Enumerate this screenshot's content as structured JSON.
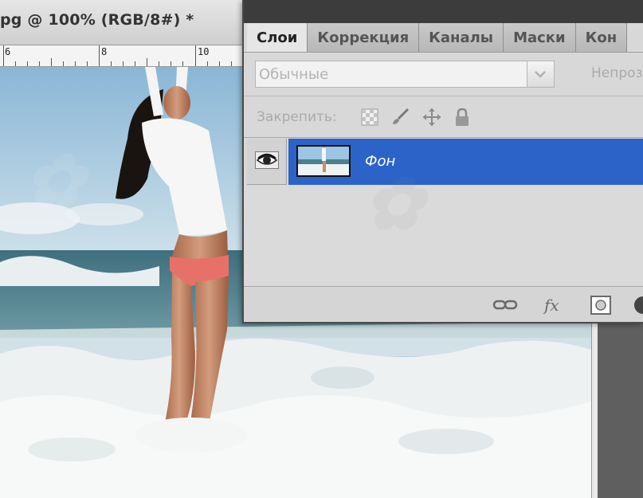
{
  "document": {
    "title": "pg @ 100% (RGB/8#) *",
    "ruler_numbers": [
      "6",
      "8",
      "10"
    ]
  },
  "layers_panel": {
    "tabs": [
      {
        "label": "Слои",
        "active": true
      },
      {
        "label": "Коррекция",
        "active": false
      },
      {
        "label": "Каналы",
        "active": false
      },
      {
        "label": "Маски",
        "active": false
      },
      {
        "label": "Кон",
        "active": false
      }
    ],
    "blend_mode": "Обычные",
    "opacity_label": "Непроз",
    "lock_label": "Закрепить:",
    "lock_icons": [
      "lock-transparent-pixels-icon",
      "lock-image-pixels-icon",
      "lock-position-icon",
      "lock-all-icon"
    ],
    "layers": [
      {
        "name": "Фон",
        "visible": true,
        "selected": true
      }
    ],
    "footer_icons": [
      "link-layers-icon",
      "fx-icon",
      "add-mask-icon",
      "adjustment-layer-icon"
    ]
  },
  "colors": {
    "selection": "#2b63c8",
    "panel_bg": "#d8d8d8",
    "tab_bar_dark": "#3c3c3c"
  }
}
